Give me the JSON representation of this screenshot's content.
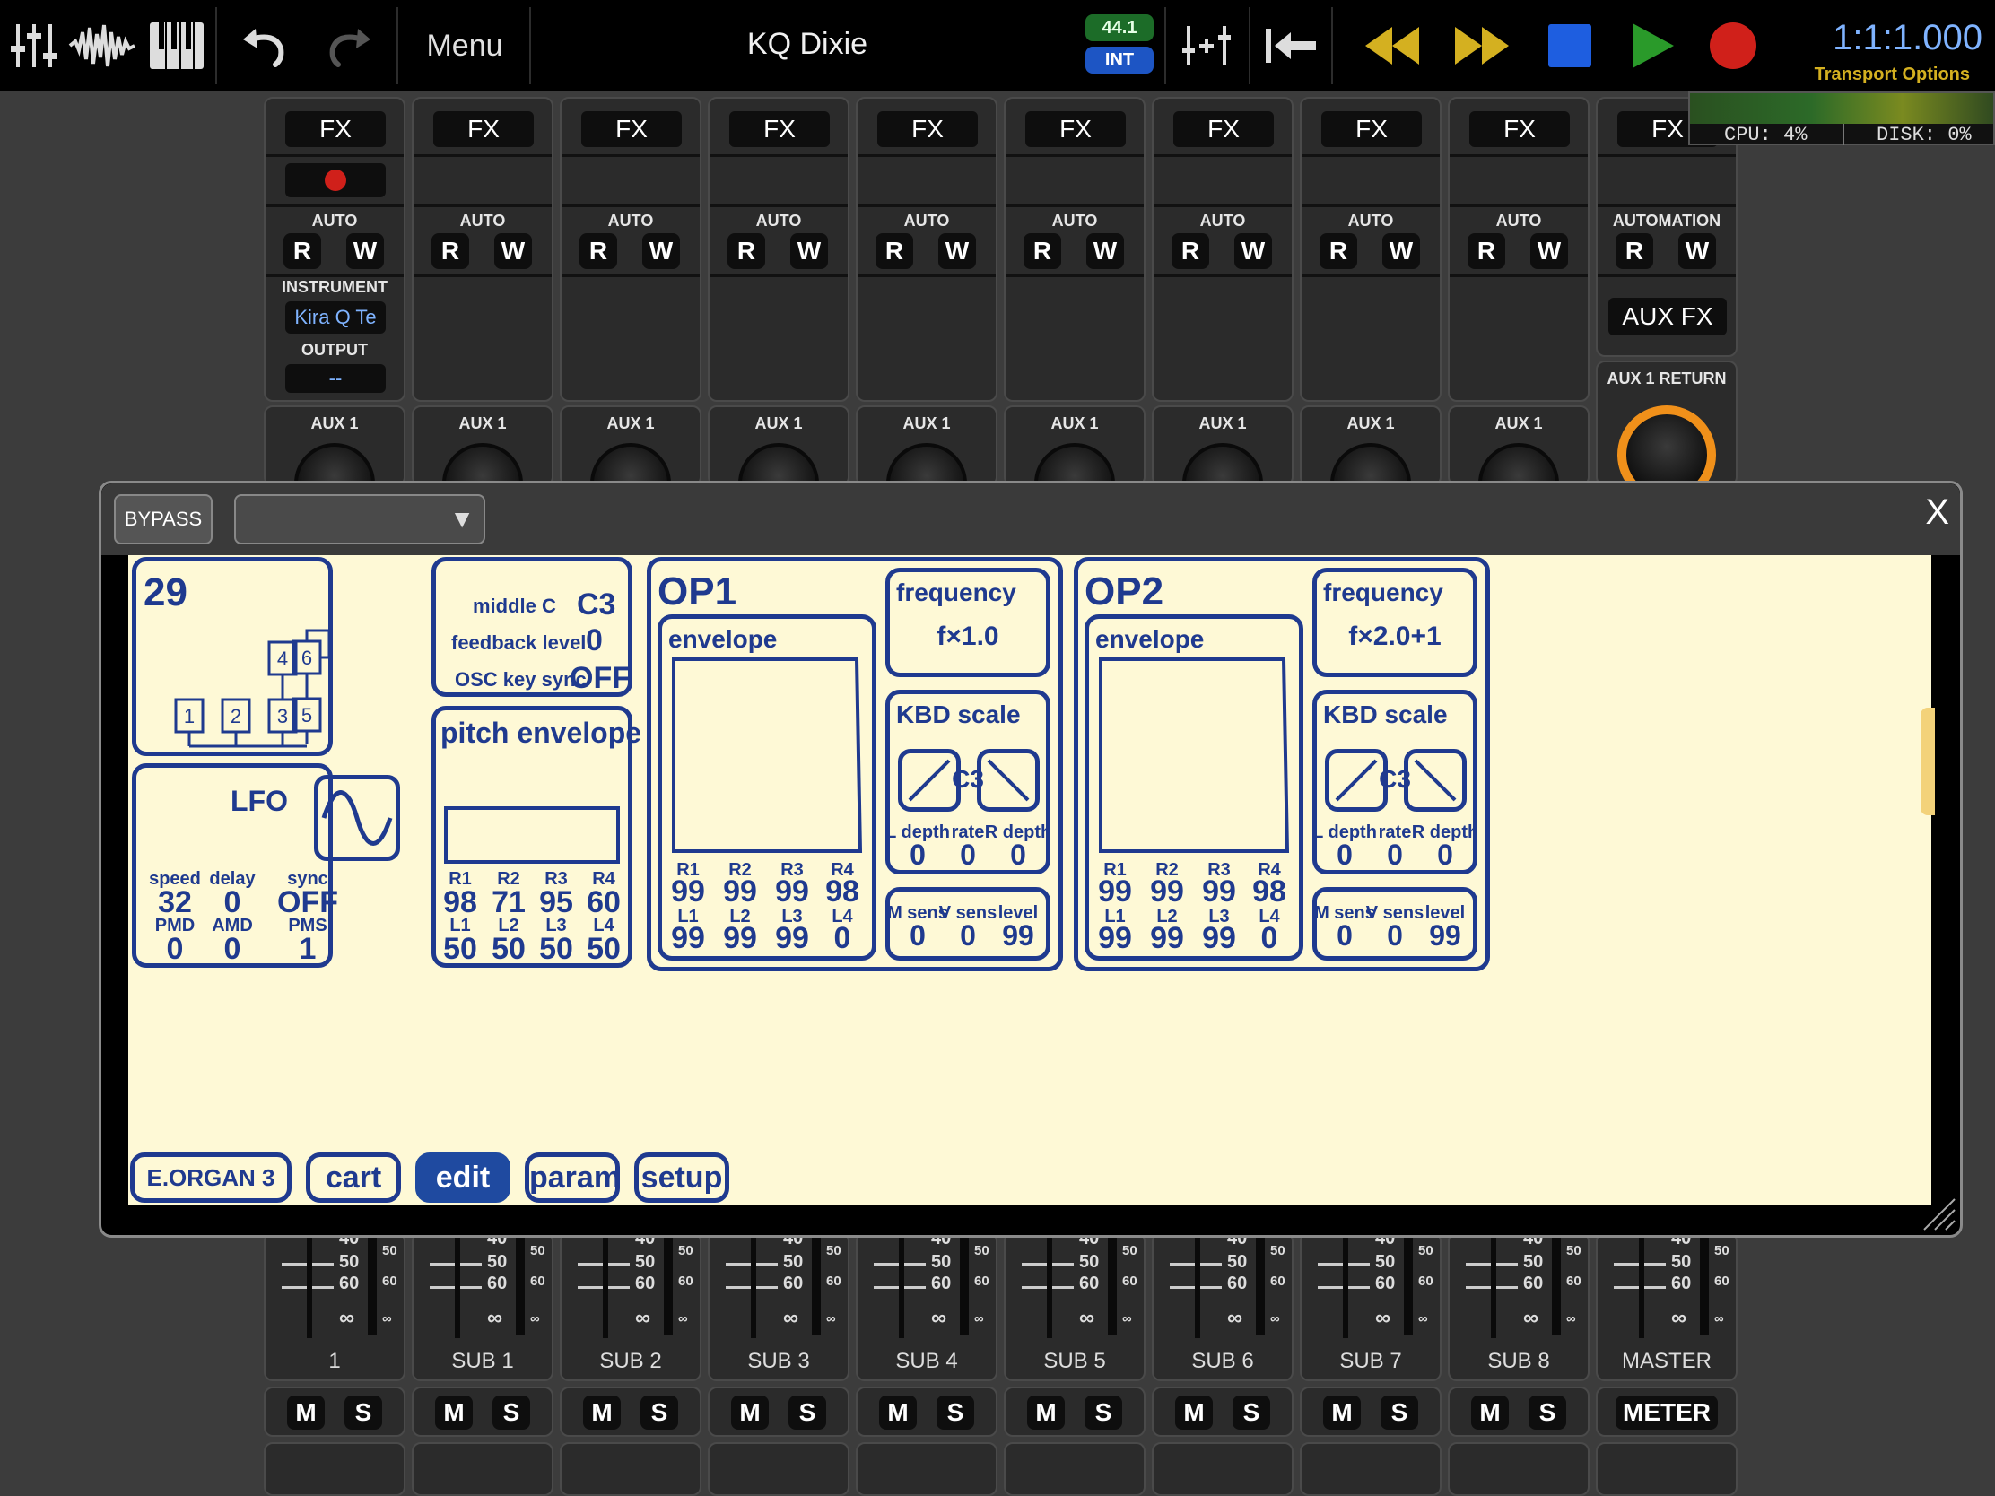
{
  "toolbar": {
    "menu_label": "Menu",
    "song_title": "KQ Dixie",
    "sample_rate": "44.1",
    "clock_source": "INT",
    "position": "1:1:1.000",
    "transport_options": "Transport Options",
    "icons": [
      "mixer-icon",
      "waveform-icon",
      "piano-icon",
      "undo-icon",
      "redo-icon",
      "add-track-icon",
      "return-to-start-icon",
      "rewind-icon",
      "fast-forward-icon",
      "stop-icon",
      "play-icon",
      "record-icon"
    ],
    "colors": {
      "transport": "#d4b020",
      "play": "#2a9a2a",
      "record": "#d0201a",
      "stop": "#1e5ee0",
      "position": "#7fb3ff"
    }
  },
  "meters": {
    "cpu": "CPU:  4%",
    "disk": "DISK:  0%"
  },
  "strips": {
    "fx_label": "FX",
    "auto_label": "AUTO",
    "automation_label": "AUTOMATION",
    "r_label": "R",
    "w_label": "W",
    "instrument_label": "INSTRUMENT",
    "instrument_value": "Kira Q Te",
    "output_label": "OUTPUT",
    "output_value": "--",
    "aux_fx_label": "AUX FX",
    "aux_return_label": "AUX 1 RETURN",
    "aux_send_label": "AUX 1",
    "channel_names": [
      "1",
      "SUB 1",
      "SUB 2",
      "SUB 3",
      "SUB 4",
      "SUB 5",
      "SUB 6",
      "SUB 7",
      "SUB 8",
      "MASTER"
    ],
    "mute_label": "M",
    "solo_label": "S",
    "meter_label": "METER",
    "fader_scale": [
      "40",
      "50",
      "60",
      "∞"
    ],
    "vu_scale": [
      "50",
      "60",
      "∞"
    ]
  },
  "plugin": {
    "bypass_label": "BYPASS",
    "preset_value": "",
    "close_label": "X"
  },
  "synth": {
    "algorithm": {
      "number": "29",
      "ops": [
        "1",
        "2",
        "3",
        "4",
        "5",
        "6"
      ]
    },
    "global": {
      "middle_c_label": "middle C",
      "middle_c_value": "C3",
      "feedback_label": "feedback level",
      "feedback_value": "0",
      "osc_sync_label": "OSC key sync",
      "osc_sync_value": "OFF"
    },
    "lfo": {
      "title": "LFO",
      "params": [
        {
          "label": "speed",
          "value": "32"
        },
        {
          "label": "delay",
          "value": "0"
        },
        {
          "label": "sync",
          "value": "OFF"
        },
        {
          "label": "PMD",
          "value": "0"
        },
        {
          "label": "AMD",
          "value": "0"
        },
        {
          "label": "PMS",
          "value": "1"
        }
      ]
    },
    "pitch_env": {
      "title": "pitch envelope",
      "rates": [
        {
          "label": "R1",
          "value": "98"
        },
        {
          "label": "R2",
          "value": "71"
        },
        {
          "label": "R3",
          "value": "95"
        },
        {
          "label": "R4",
          "value": "60"
        }
      ],
      "levels": [
        {
          "label": "L1",
          "value": "50"
        },
        {
          "label": "L2",
          "value": "50"
        },
        {
          "label": "L3",
          "value": "50"
        },
        {
          "label": "L4",
          "value": "50"
        }
      ]
    },
    "op1": {
      "title": "OP1",
      "envelope_label": "envelope",
      "rates": [
        {
          "label": "R1",
          "value": "99"
        },
        {
          "label": "R2",
          "value": "99"
        },
        {
          "label": "R3",
          "value": "99"
        },
        {
          "label": "R4",
          "value": "98"
        }
      ],
      "levels": [
        {
          "label": "L1",
          "value": "99"
        },
        {
          "label": "L2",
          "value": "99"
        },
        {
          "label": "L3",
          "value": "99"
        },
        {
          "label": "L4",
          "value": "0"
        }
      ],
      "frequency_label": "frequency",
      "frequency_value": "f×1.0",
      "kbd_label": "KBD scale",
      "kbd_break": "C3",
      "l_depth_label": "L depth",
      "l_depth": "0",
      "rate_label": "rate",
      "rate": "0",
      "r_depth_label": "R depth",
      "r_depth": "0",
      "m_sens_label": "M sens",
      "m_sens": "0",
      "v_sens_label": "V sens",
      "v_sens": "0",
      "level_label": "level",
      "level": "99"
    },
    "op2": {
      "title": "OP2",
      "envelope_label": "envelope",
      "rates": [
        {
          "label": "R1",
          "value": "99"
        },
        {
          "label": "R2",
          "value": "99"
        },
        {
          "label": "R3",
          "value": "99"
        },
        {
          "label": "R4",
          "value": "98"
        }
      ],
      "levels": [
        {
          "label": "L1",
          "value": "99"
        },
        {
          "label": "L2",
          "value": "99"
        },
        {
          "label": "L3",
          "value": "99"
        },
        {
          "label": "L4",
          "value": "0"
        }
      ],
      "frequency_label": "frequency",
      "frequency_value": "f×2.0+1",
      "kbd_label": "KBD scale",
      "kbd_break": "C3",
      "l_depth_label": "L depth",
      "l_depth": "0",
      "rate_label": "rate",
      "rate": "0",
      "r_depth_label": "R depth",
      "r_depth": "0",
      "m_sens_label": "M sens",
      "m_sens": "0",
      "v_sens_label": "V sens",
      "v_sens": "0",
      "level_label": "level",
      "level": "99"
    },
    "tabs": {
      "patch_name": "E.ORGAN 3",
      "cart": "cart",
      "edit": "edit",
      "param": "param",
      "setup": "setup",
      "active": "edit"
    },
    "colors": {
      "panel": "#fef9d6",
      "ink": "#1f3a8f",
      "active_tab": "#1f4aa0"
    }
  }
}
